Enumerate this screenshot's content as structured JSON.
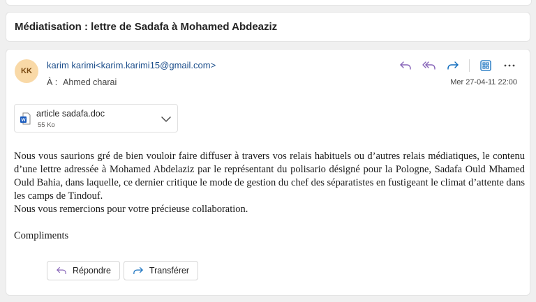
{
  "email": {
    "subject": "Médiatisation : lettre de Sadafa à Mohamed Abdeaziz",
    "avatar_initials": "KK",
    "sender": "karim karimi<karim.karimi15@gmail.com>",
    "to_label": "À :",
    "to_name": "Ahmed charai",
    "datetime": "Mer 27-04-11 22:00",
    "attachment": {
      "name": "article sadafa.doc",
      "size": "55 Ko",
      "icon": "word-doc-icon"
    },
    "body_paragraph": "Nous vous saurions gré de bien vouloir faire diffuser à travers vos relais habituels ou d’autres relais médiatiques, le contenu d’une lettre adressée à Mohamed Abdelaziz par le représentant du polisario désigné pour la Pologne, Sadafa Ould Mhamed Ould Bahia, dans laquelle, ce dernier critique le mode de gestion du chef des séparatistes en fustigeant le climat d’attente dans les camps de Tindouf.",
    "body_thanks": "Nous vous remercions pour votre précieuse collaboration.",
    "body_closing": "Compliments"
  },
  "actions": {
    "reply_label": "Répondre",
    "forward_label": "Transférer",
    "icons": [
      "reply-icon",
      "reply-all-icon",
      "forward-icon",
      "apps-icon",
      "more-icon"
    ]
  },
  "colors": {
    "accent_purple": "#8764b8",
    "accent_blue": "#0f6cbd",
    "sender_blue": "#1c4e8b",
    "avatar_bg": "#f9d9a7"
  }
}
